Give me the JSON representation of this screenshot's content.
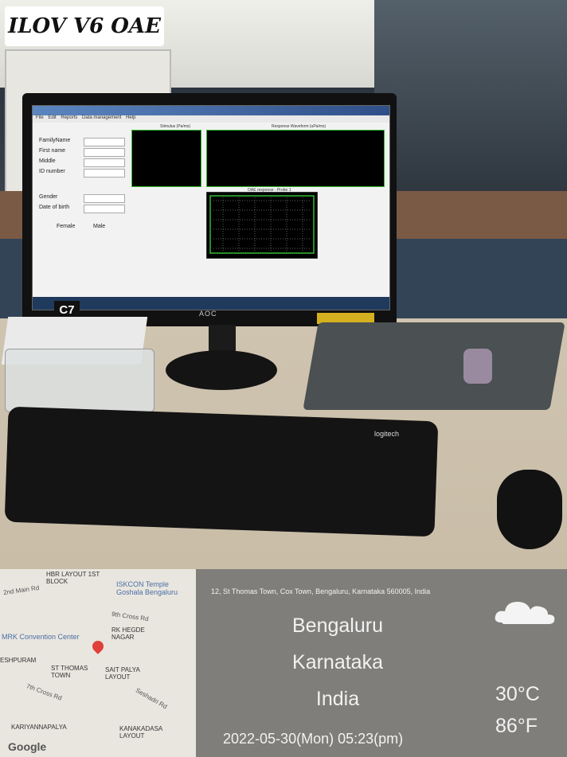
{
  "photo_label": {
    "text": "ILOV V6 OAE"
  },
  "monitor": {
    "brand": "AOC",
    "sticker": "C7",
    "screen": {
      "menu": [
        "File",
        "Edit",
        "Reports",
        "Data management",
        "Help"
      ],
      "fields": [
        "FamilyName",
        "First name",
        "Middle",
        "ID number",
        "Gender",
        "Date of birth",
        "Female",
        "Male"
      ],
      "graph_titles": [
        "Stimulus (Pa/ms)",
        "Response Waveform (uPa/ms)",
        "OAE response - Probe 1"
      ]
    }
  },
  "keyboard": {
    "brand": "logitech"
  },
  "map": {
    "places": [
      "ISKCON Temple Goshala Bengaluru",
      "RK HEGDE NAGAR",
      "MRK Convention Center",
      "ST THOMAS TOWN",
      "SAIT PALYA LAYOUT",
      "KARIYANNAPALYA",
      "KANAKADASA LAYOUT",
      "ESHPURAM",
      "HBR LAYOUT 1ST BLOCK"
    ],
    "roads": [
      "2nd Main Rd",
      "9th Cross Rd",
      "7th Cross Rd",
      "Seshadri Rd"
    ],
    "attribution": "Google"
  },
  "location": {
    "address": "12, St Thomas Town, Cox Town, Bengaluru, Karnataka 560005, India",
    "city": "Bengaluru",
    "state": "Karnataka",
    "country": "India",
    "datetime": "2022-05-30(Mon)   05:23(pm)",
    "temp_c": "30°C",
    "temp_f": "86°F",
    "weather_icon": "cloud-icon"
  }
}
